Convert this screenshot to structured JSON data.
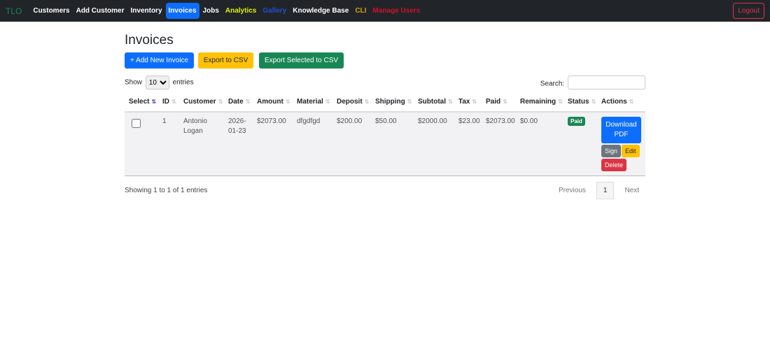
{
  "nav": {
    "brand": "TLO",
    "items": [
      {
        "label": "Customers",
        "color": "#ffffff"
      },
      {
        "label": "Add Customer",
        "color": "#ffffff"
      },
      {
        "label": "Inventory",
        "color": "#ffffff"
      },
      {
        "label": "Invoices",
        "color": "#ffffff",
        "active": true
      },
      {
        "label": "Jobs",
        "color": "#ffffff"
      },
      {
        "label": "Analytics",
        "color": "#e0f000"
      },
      {
        "label": "Gallery",
        "color": "#1f4fd0"
      },
      {
        "label": "Knowledge Base",
        "color": "#ffffff"
      },
      {
        "label": "CLI",
        "color": "#d4a017"
      },
      {
        "label": "Manage Users",
        "color": "#d0102a"
      }
    ],
    "logout": "Logout"
  },
  "page": {
    "title": "Invoices",
    "add": "+ Add New Invoice",
    "export": "Export to CSV",
    "export_selected": "Export Selected to CSV"
  },
  "controls": {
    "show": "Show",
    "entries": "entries",
    "page_size": "10",
    "search": "Search:",
    "search_value": ""
  },
  "table": {
    "headers": [
      "Select",
      "ID",
      "Customer",
      "Date",
      "Amount",
      "Material",
      "Deposit",
      "Shipping",
      "Subtotal",
      "Tax",
      "Paid",
      "Remaining",
      "Status",
      "Actions"
    ],
    "rows": [
      {
        "id": "1",
        "customer": "Antonio Logan",
        "date": "2026-01-23",
        "amount": "$2073.00",
        "material": "dfgdfgd",
        "deposit": "$200.00",
        "shipping": "$50.00",
        "subtotal": "$2000.00",
        "tax": "$23.00",
        "paid": "$2073.00",
        "remaining": "$0.00",
        "status": "Paid",
        "actions": {
          "download": "Download PDF",
          "sign": "Sign",
          "edit": "Edit",
          "delete": "Delete"
        }
      }
    ]
  },
  "footer": {
    "info": "Showing 1 to 1 of 1 entries",
    "previous": "Previous",
    "page": "1",
    "next": "Next"
  }
}
